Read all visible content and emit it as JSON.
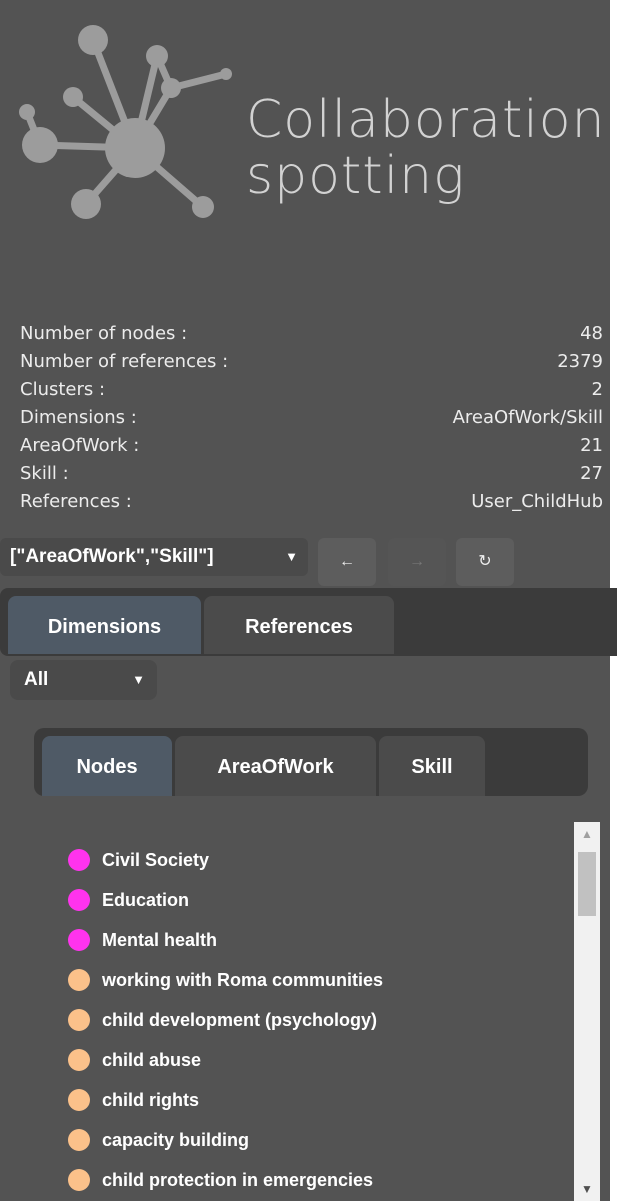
{
  "logo": {
    "line1": "Collaboration",
    "line2": "spotting"
  },
  "stats": [
    {
      "label": "Number of nodes :",
      "value": "48"
    },
    {
      "label": "Number of references :",
      "value": "2379"
    },
    {
      "label": "Clusters :",
      "value": "2"
    },
    {
      "label": "Dimensions :",
      "value": "AreaOfWork/Skill"
    },
    {
      "label": "AreaOfWork :",
      "value": "21"
    },
    {
      "label": "Skill :",
      "value": "27"
    },
    {
      "label": "References :",
      "value": "User_ChildHub"
    }
  ],
  "toolbar": {
    "dimension_select": "[\"AreaOfWork\",\"Skill\"]",
    "back_icon": "←",
    "forward_icon": "→",
    "refresh_icon": "↻"
  },
  "main_tabs": [
    {
      "label": "Dimensions",
      "active": true
    },
    {
      "label": "References",
      "active": false
    }
  ],
  "filter": {
    "selected": "All"
  },
  "sub_tabs": [
    {
      "label": "Nodes",
      "active": true
    },
    {
      "label": "AreaOfWork",
      "active": false
    },
    {
      "label": "Skill",
      "active": false
    }
  ],
  "colors": {
    "areaofwork": "#ff33ee",
    "skill": "#fbc18a"
  },
  "nodes": [
    {
      "label": "Civil Society",
      "group": "areaofwork"
    },
    {
      "label": "Education",
      "group": "areaofwork"
    },
    {
      "label": "Mental health",
      "group": "areaofwork"
    },
    {
      "label": "working with Roma communities",
      "group": "skill"
    },
    {
      "label": "child development (psychology)",
      "group": "skill"
    },
    {
      "label": "child abuse",
      "group": "skill"
    },
    {
      "label": "child rights",
      "group": "skill"
    },
    {
      "label": "capacity building",
      "group": "skill"
    },
    {
      "label": "child protection in emergencies",
      "group": "skill"
    }
  ]
}
